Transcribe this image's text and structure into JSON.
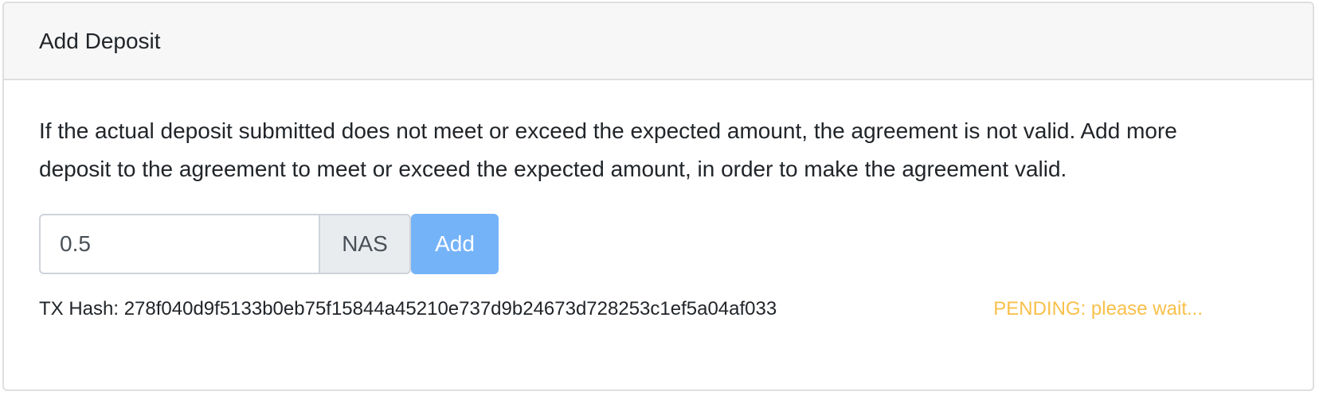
{
  "card": {
    "title": "Add Deposit",
    "description": "If the actual deposit submitted does not meet or exceed the expected amount, the agreement is not valid. Add more deposit to the agreement to meet or exceed the expected amount, in order to make the agreement valid."
  },
  "deposit_form": {
    "amount_value": "0.5",
    "unit_label": "NAS",
    "add_label": "Add"
  },
  "transaction": {
    "hash_text": "TX Hash: 278f040d9f5133b0eb75f15844a45210e737d9b24673d728253c1ef5a04af033",
    "status_text": "PENDING: please wait...",
    "status_color": "#f9c04a"
  },
  "colors": {
    "button_accent": "#75b3f9",
    "header_background": "#f7f7f7"
  }
}
